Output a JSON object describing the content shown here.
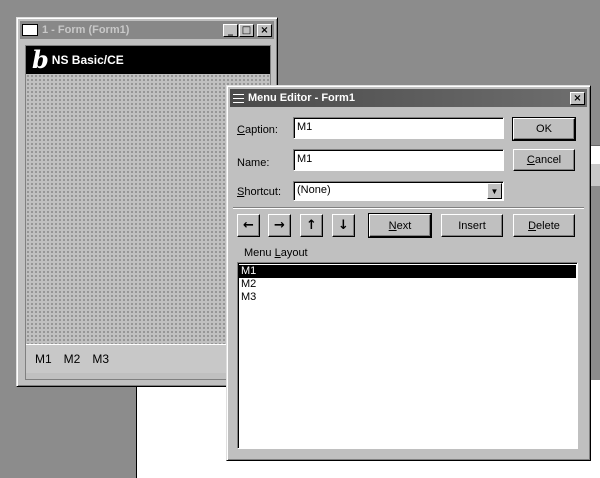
{
  "form_window": {
    "title": "1 - Form (Form1)",
    "buttons": {
      "minimize": "_",
      "maximize": "□",
      "close": "×"
    },
    "header_logo": "b",
    "header_title": "NS Basic/CE",
    "menu_items": [
      "M1",
      "M2",
      "M3"
    ]
  },
  "menu_editor": {
    "title": "Menu Editor - Form1",
    "close_label": "×",
    "caption": {
      "label_prefix": "C",
      "label_rest": "aption:",
      "value": "M1"
    },
    "name": {
      "label": "Name:",
      "value": "M1"
    },
    "shortcut": {
      "label_prefix": "S",
      "label_rest": "hortcut:",
      "value": "(None)"
    },
    "ok_label": "OK",
    "cancel_prefix": "C",
    "cancel_rest": "ancel",
    "arrows": {
      "left": "←",
      "right": "→",
      "up": "↑",
      "down": "↓"
    },
    "next_prefix": "N",
    "next_rest": "ext",
    "insert_label": "Insert",
    "delete_prefix": "D",
    "delete_rest": "elete",
    "layout_label_a": "Menu ",
    "layout_label_u": "L",
    "layout_label_b": "ayout",
    "layout_items": [
      "M1",
      "M2",
      "M3"
    ],
    "selected_index": 0
  }
}
